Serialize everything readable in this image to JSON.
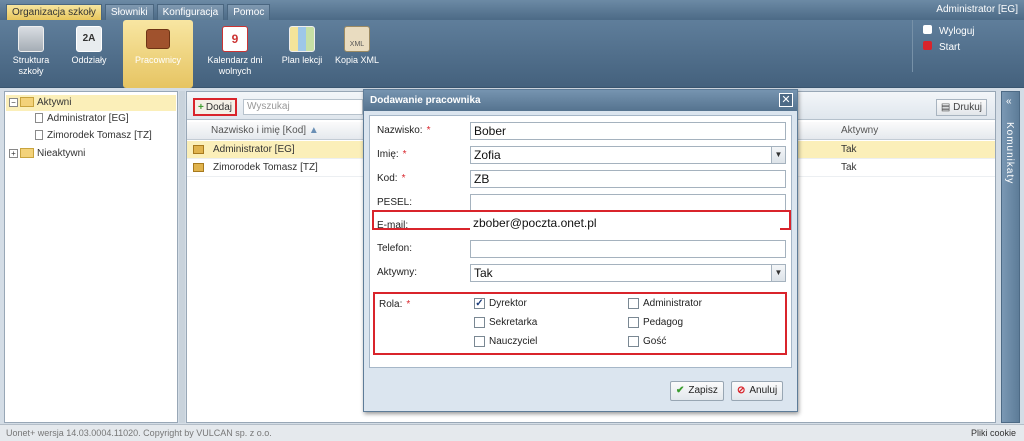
{
  "top": {
    "tabs": [
      "Organizacja szkoły",
      "Słowniki",
      "Konfiguracja",
      "Pomoc"
    ],
    "user": "Administrator [EG]"
  },
  "ribbon": {
    "buttons": [
      {
        "label": "Struktura szkoły",
        "icon": "school-structure-icon"
      },
      {
        "label": "Oddziały",
        "icon": "class-icon"
      },
      {
        "label": "Pracownicy",
        "icon": "briefcase-icon"
      },
      {
        "label": "Kalendarz dni wolnych",
        "icon": "calendar-icon"
      },
      {
        "label": "Plan lekcji",
        "icon": "timetable-icon"
      },
      {
        "label": "Kopia XML",
        "icon": "xml-icon"
      }
    ],
    "logout": "Wyloguj",
    "start": "Start"
  },
  "tree": {
    "active": "Aktywni",
    "items": [
      "Administrator [EG]",
      "Zimorodek Tomasz [TZ]"
    ],
    "inactive": "Nieaktywni"
  },
  "toolbar": {
    "add": "Dodaj",
    "search_placeholder": "Wyszukaj",
    "print": "Drukuj"
  },
  "grid": {
    "col_name": "Nazwisko i imię [Kod]",
    "col_active": "Aktywny",
    "rows": [
      {
        "name": "Administrator [EG]",
        "active": "Tak"
      },
      {
        "name": "Zimorodek Tomasz [TZ]",
        "active": "Tak"
      }
    ]
  },
  "sidebar_right": "Komunikaty",
  "footer": {
    "version": "Uonet+ wersja 14.03.0004.11020. Copyright by VULCAN sp. z o.o.",
    "cookies": "Pliki cookie"
  },
  "dialog": {
    "title": "Dodawanie pracownika",
    "labels": {
      "surname": "Nazwisko:",
      "firstname": "Imię:",
      "code": "Kod:",
      "pesel": "PESEL:",
      "email": "E-mail:",
      "phone": "Telefon:",
      "active": "Aktywny:",
      "role": "Rola:"
    },
    "values": {
      "surname": "Bober",
      "firstname": "Zofia",
      "code": "ZB",
      "pesel": "",
      "email": "zbober@poczta.onet.pl",
      "phone": "",
      "active": "Tak"
    },
    "roles": [
      {
        "label": "Dyrektor",
        "checked": true
      },
      {
        "label": "Administrator",
        "checked": false
      },
      {
        "label": "Sekretarka",
        "checked": false
      },
      {
        "label": "Pedagog",
        "checked": false
      },
      {
        "label": "Nauczyciel",
        "checked": false
      },
      {
        "label": "Gość",
        "checked": false
      }
    ],
    "save": "Zapisz",
    "cancel": "Anuluj"
  }
}
